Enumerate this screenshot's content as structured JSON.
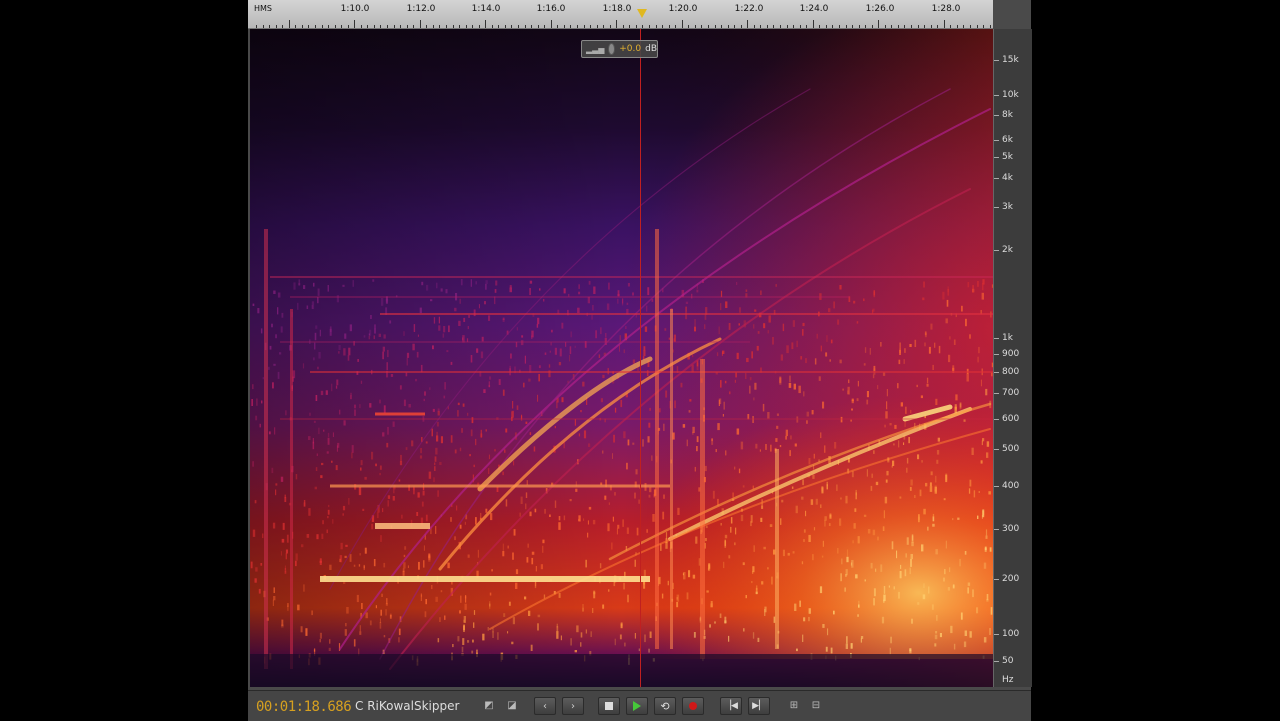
{
  "ruler": {
    "format_label": "HMS",
    "ticks": [
      "1:10.0",
      "1:12.0",
      "1:14.0",
      "1:16.0",
      "1:18.0",
      "1:20.0",
      "1:22.0",
      "1:24.0",
      "1:26.0",
      "1:28.0"
    ]
  },
  "hud": {
    "gain": "+0.0",
    "unit": "dB"
  },
  "freq_axis": {
    "labels": [
      "15k",
      "10k",
      "8k",
      "6k",
      "5k",
      "4k",
      "3k",
      "2k",
      "1k",
      "900",
      "800",
      "700",
      "600",
      "500",
      "400",
      "300",
      "200",
      "100",
      "50",
      "Hz"
    ]
  },
  "transport": {
    "time": "00:01:18.686",
    "credit": "C RiKowalSkipper",
    "buttons": [
      "marquee-select-icon",
      "lasso-select-icon",
      "chevron-left-icon",
      "chevron-right-icon",
      "stop-icon",
      "play-icon",
      "loop-icon",
      "record-icon",
      "skip-start-icon",
      "skip-end-icon",
      "zoom-in-amplitude-icon",
      "zoom-out-amplitude-icon"
    ]
  },
  "colors": {
    "playhead": "#e0b820",
    "time": "#d6a020",
    "accent": "#e0b030"
  }
}
